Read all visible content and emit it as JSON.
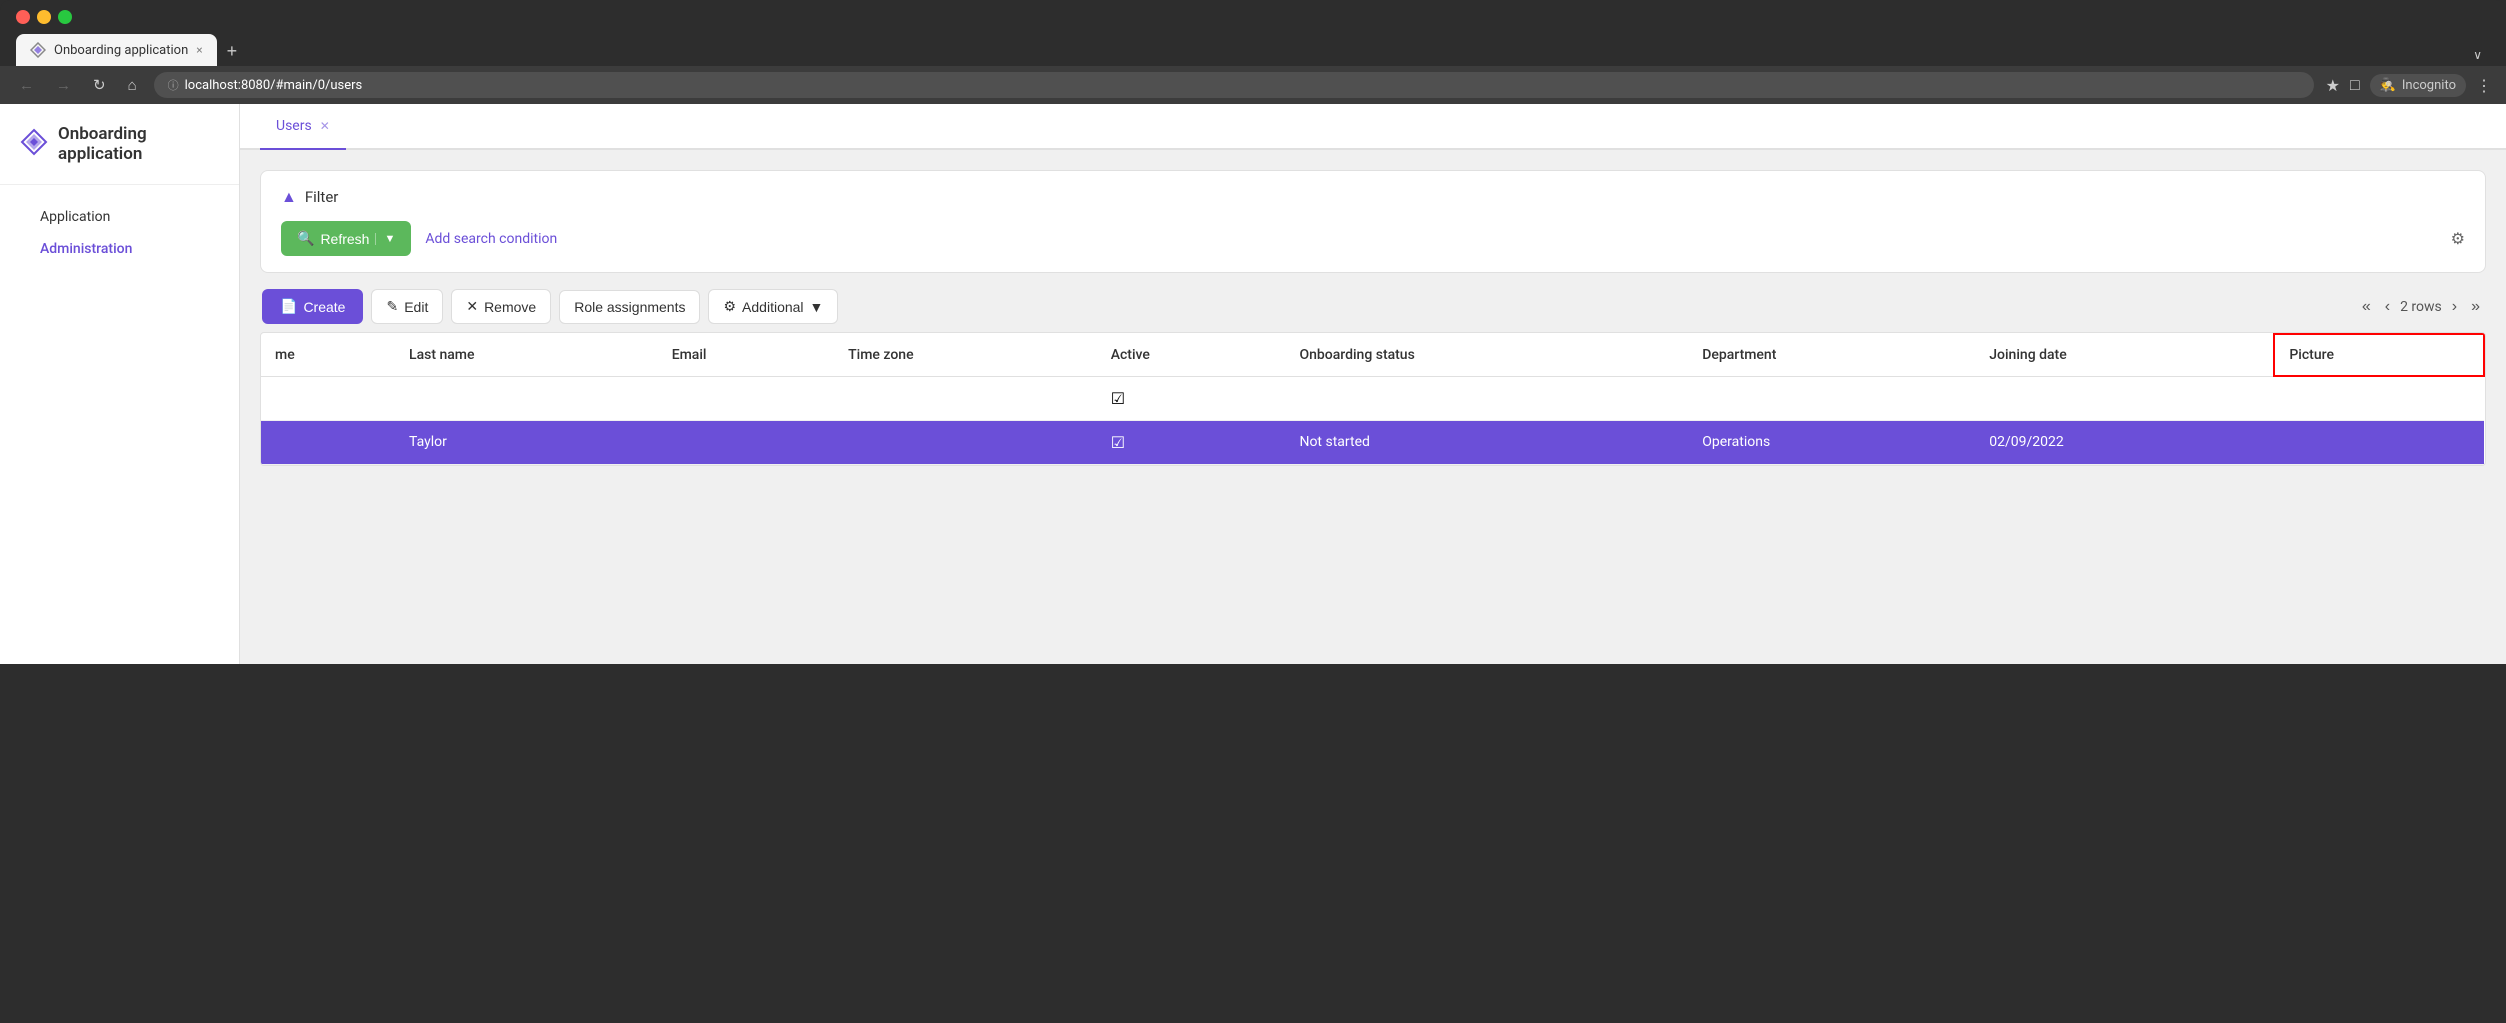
{
  "browser": {
    "url": "localhost:8080/#main/0/users",
    "tab_title": "Onboarding application",
    "tab_close": "×",
    "new_tab": "+",
    "dropdown": "∨",
    "incognito_label": "Incognito"
  },
  "app": {
    "title": "Onboarding application"
  },
  "sidebar": {
    "items": [
      {
        "id": "application",
        "label": "Application",
        "active": false
      },
      {
        "id": "administration",
        "label": "Administration",
        "active": true
      }
    ]
  },
  "tabs": [
    {
      "id": "users",
      "label": "Users",
      "active": true
    }
  ],
  "filter": {
    "title": "Filter",
    "refresh_label": "Refresh",
    "add_condition_label": "Add search condition",
    "settings_icon": "gear"
  },
  "toolbar": {
    "create_label": "Create",
    "edit_label": "Edit",
    "remove_label": "Remove",
    "role_assignments_label": "Role assignments",
    "additional_label": "Additional",
    "rows_count": "2 rows"
  },
  "table": {
    "columns": [
      {
        "id": "name",
        "label": "me"
      },
      {
        "id": "last_name",
        "label": "Last name"
      },
      {
        "id": "email",
        "label": "Email"
      },
      {
        "id": "time_zone",
        "label": "Time zone"
      },
      {
        "id": "active",
        "label": "Active"
      },
      {
        "id": "onboarding_status",
        "label": "Onboarding status"
      },
      {
        "id": "department",
        "label": "Department"
      },
      {
        "id": "joining_date",
        "label": "Joining date"
      },
      {
        "id": "picture",
        "label": "Picture"
      }
    ],
    "rows": [
      {
        "name": "",
        "last_name": "",
        "email": "",
        "time_zone": "",
        "active": true,
        "onboarding_status": "",
        "department": "",
        "joining_date": "",
        "picture": "",
        "selected": false
      },
      {
        "name": "",
        "last_name": "Taylor",
        "email": "",
        "time_zone": "",
        "active": true,
        "onboarding_status": "Not started",
        "department": "Operations",
        "joining_date": "02/09/2022",
        "picture": "",
        "selected": true
      }
    ]
  }
}
